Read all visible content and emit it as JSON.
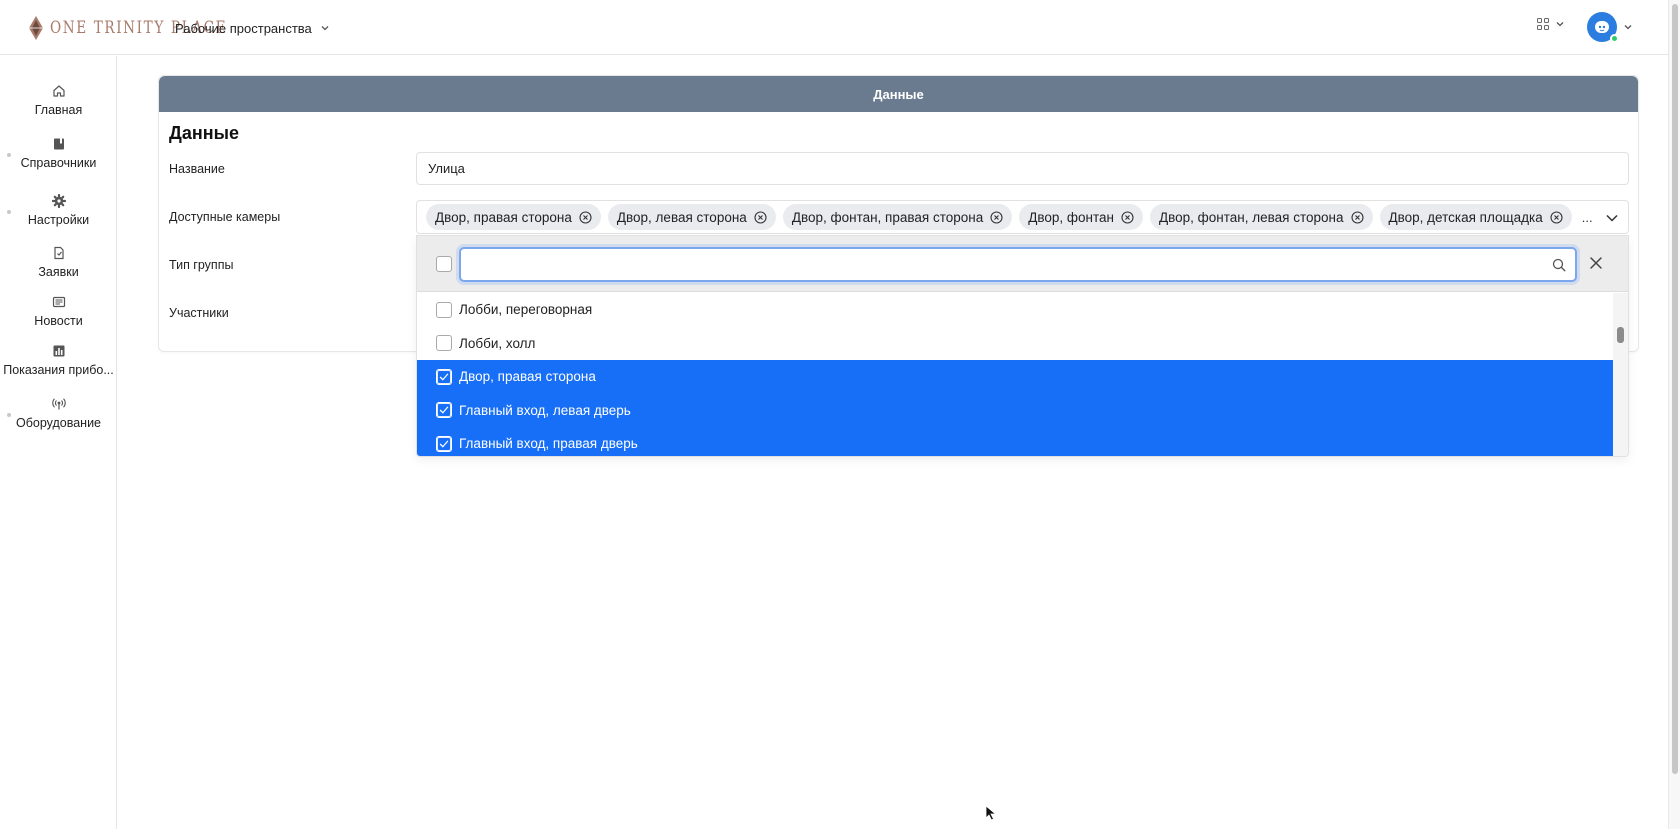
{
  "header": {
    "logo_text": "ONE TRINITY PLACE",
    "workspace_label": "Рабочие пространства"
  },
  "sidebar": {
    "items": [
      {
        "label": "Главная",
        "icon": "home-icon"
      },
      {
        "label": "Справочники",
        "icon": "book-icon"
      },
      {
        "label": "Настройки",
        "icon": "gear-icon"
      },
      {
        "label": "Заявки",
        "icon": "document-icon"
      },
      {
        "label": "Новости",
        "icon": "newspaper-icon"
      },
      {
        "label": "Показания прибо...",
        "icon": "bar-chart-icon"
      },
      {
        "label": "Оборудование",
        "icon": "broadcast-icon"
      }
    ]
  },
  "card": {
    "header_title": "Данные",
    "section_title": "Данные",
    "fields": {
      "name_label": "Название",
      "name_value": "Улица",
      "cameras_label": "Доступные камеры",
      "group_type_label": "Тип группы",
      "participants_label": "Участники"
    },
    "selected_cameras": [
      "Двор, правая сторона",
      "Двор, левая сторона",
      "Двор, фонтан, правая сторона",
      "Двор, фонтан",
      "Двор, фонтан, левая сторона",
      "Двор, детская площадка"
    ],
    "more_indicator": "..."
  },
  "dropdown": {
    "search_value": "",
    "options": [
      {
        "label": "Лобби, переговорная",
        "checked": false
      },
      {
        "label": "Лобби, холл",
        "checked": false
      },
      {
        "label": "Двор, правая сторона",
        "checked": true
      },
      {
        "label": "Главный вход, левая дверь",
        "checked": true
      },
      {
        "label": "Главный вход, правая дверь",
        "checked": true
      }
    ]
  },
  "colors": {
    "card_header": "#6b7b8f",
    "selected_option": "#176ef7",
    "logo": "#a87a6a",
    "online_status": "#2fc96b"
  }
}
